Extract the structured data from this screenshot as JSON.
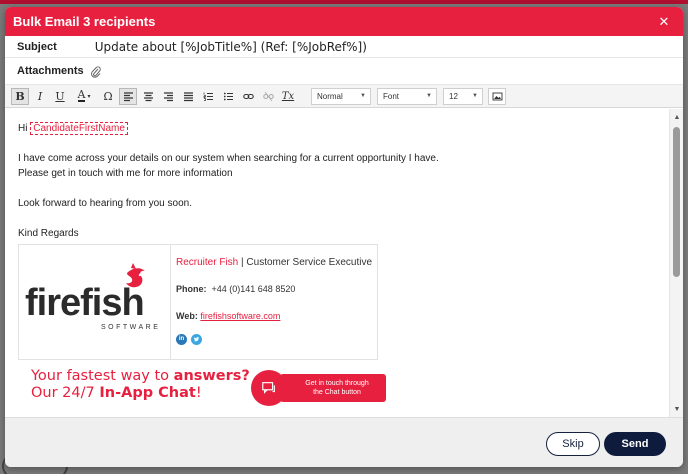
{
  "modal": {
    "title": "Bulk Email 3 recipients",
    "close_icon": "close-icon"
  },
  "fields": {
    "subject_label": "Subject",
    "subject_value": "Update about [%JobTitle%] (Ref: [%JobRef%])",
    "attachments_label": "Attachments"
  },
  "toolbar": {
    "bold": "B",
    "italic": "I",
    "underline": "U",
    "font_color": "A",
    "special_char": "Ω",
    "clear_format": "Tx",
    "format_select": "Normal",
    "font_select": "Font",
    "size_select": "12"
  },
  "body": {
    "greeting": "Hi",
    "merge_field": "CandidateFirstName",
    "line1": "I have come across your details on our system when searching for a current opportunity I have.",
    "line2": "Please get in touch with me for more information",
    "line3": "Look forward to hearing from you soon.",
    "line4": "Kind Regards"
  },
  "signature": {
    "company": "Recruiter Fish",
    "separator": "|",
    "role": "Customer Service Executive",
    "phone_label": "Phone:",
    "phone_value": "+44 (0)141 648 8520",
    "web_label": "Web:",
    "web_value": "firefishsoftware.com",
    "logo_text": "firefish",
    "logo_sub": "SOFTWARE"
  },
  "banner": {
    "line1_plain": "Your fastest way to ",
    "line1_bold": "answers?",
    "line2_plain": "Our 24/7 ",
    "line2_bold": "In-App Chat",
    "line2_end": "!",
    "pill_line1": "Get in touch through",
    "pill_line2": "the Chat button"
  },
  "footer": {
    "skip_label": "Skip",
    "send_label": "Send"
  },
  "colors": {
    "brand_red": "#e8203f",
    "navy": "#0f1b3d"
  }
}
